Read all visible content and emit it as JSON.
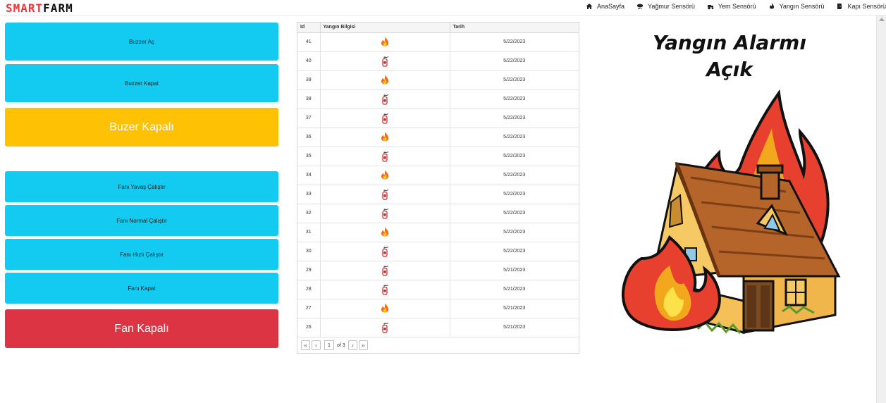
{
  "brand": {
    "smart": "SMART",
    "farm": "FARM"
  },
  "nav": [
    {
      "label": "AnaSayfa",
      "icon": "home-icon"
    },
    {
      "label": "Yağmur Sensörü",
      "icon": "rain-icon"
    },
    {
      "label": "Yem Sensörü",
      "icon": "tractor-icon"
    },
    {
      "label": "Yangın Sensörü",
      "icon": "fire-icon"
    },
    {
      "label": "Kapı Sensörü",
      "icon": "door-icon"
    }
  ],
  "buttons": {
    "buzzer_on": "Buzzer Aç",
    "buzzer_off": "Buzzer Kapat",
    "buzzer_status": "Buzer Kapalı",
    "fan_slow": "Fanı Yavaş Çalıştır",
    "fan_normal": "Fanı Normal Çalıştır",
    "fan_fast": "Fanı Hızlı Çalıştır",
    "fan_off": "Fanı Kapat",
    "fan_status": "Fan Kapalı"
  },
  "colors": {
    "cyan": "#13caf0",
    "yellow": "#fec104",
    "red": "#dd3444"
  },
  "table": {
    "headers": [
      "Id",
      "Yangın Bilgisi",
      "Tarih"
    ],
    "rows": [
      {
        "id": "41",
        "icon": "fire",
        "date": "5/22/2023"
      },
      {
        "id": "40",
        "icon": "extinguisher",
        "date": "5/22/2023"
      },
      {
        "id": "39",
        "icon": "fire",
        "date": "5/22/2023"
      },
      {
        "id": "38",
        "icon": "extinguisher",
        "date": "5/22/2023"
      },
      {
        "id": "37",
        "icon": "extinguisher",
        "date": "5/22/2023"
      },
      {
        "id": "36",
        "icon": "fire",
        "date": "5/22/2023"
      },
      {
        "id": "35",
        "icon": "extinguisher",
        "date": "5/22/2023"
      },
      {
        "id": "34",
        "icon": "fire",
        "date": "5/22/2023"
      },
      {
        "id": "33",
        "icon": "extinguisher",
        "date": "5/22/2023"
      },
      {
        "id": "32",
        "icon": "extinguisher",
        "date": "5/22/2023"
      },
      {
        "id": "31",
        "icon": "fire",
        "date": "5/22/2023"
      },
      {
        "id": "30",
        "icon": "extinguisher",
        "date": "5/22/2023"
      },
      {
        "id": "29",
        "icon": "extinguisher",
        "date": "5/21/2023"
      },
      {
        "id": "28",
        "icon": "extinguisher",
        "date": "5/21/2023"
      },
      {
        "id": "27",
        "icon": "fire",
        "date": "5/21/2023"
      },
      {
        "id": "26",
        "icon": "extinguisher",
        "date": "5/21/2023"
      }
    ],
    "pager": {
      "page": "1",
      "of": "of 3"
    }
  },
  "alarm": {
    "line1": "Yangın Alarmı",
    "line2": "Açık"
  }
}
